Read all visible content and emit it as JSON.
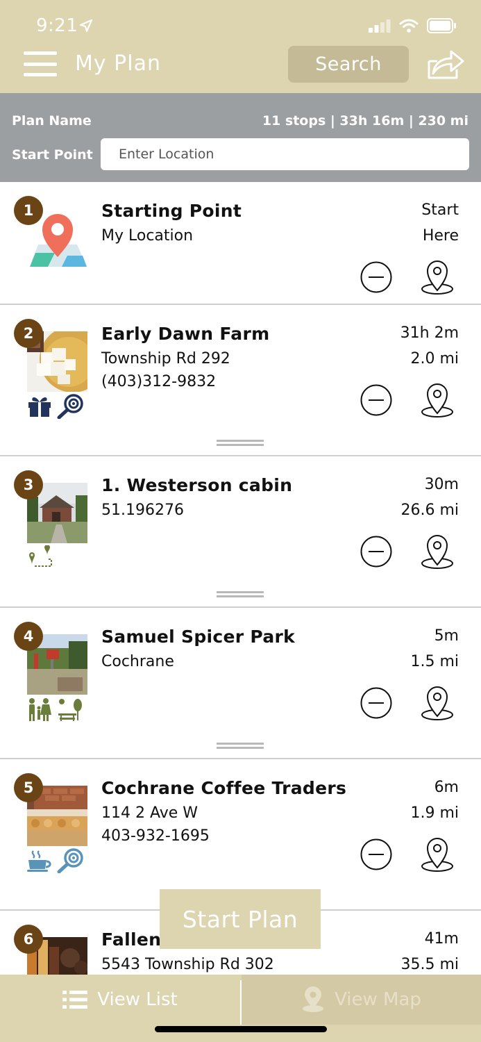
{
  "status": {
    "time": "9:21"
  },
  "header": {
    "title": "My Plan",
    "search_label": "Search"
  },
  "plan": {
    "name_label": "Plan Name",
    "stats": "11 stops | 33h 16m | 230 mi",
    "start_label": "Start Point",
    "location_placeholder": "Enter Location"
  },
  "stops": [
    {
      "num": "1",
      "name": "Starting Point",
      "line1": "My Location",
      "line2": "",
      "right1": "Start",
      "right2": "Here"
    },
    {
      "num": "2",
      "name": "Early Dawn Farm",
      "line1": "Township Rd 292",
      "line2": "(403)312-9832",
      "right1": "31h 2m",
      "right2": "2.0 mi"
    },
    {
      "num": "3",
      "name": "1. Westerson cabin",
      "line1": "51.196276",
      "line2": "",
      "right1": "30m",
      "right2": "26.6 mi"
    },
    {
      "num": "4",
      "name": "Samuel Spicer Park",
      "line1": "Cochrane",
      "line2": "",
      "right1": "5m",
      "right2": "1.5 mi"
    },
    {
      "num": "5",
      "name": "Cochrane Coffee Traders",
      "line1": "114 2 Ave W",
      "line2": "403-932-1695",
      "right1": "6m",
      "right2": "1.9 mi"
    },
    {
      "num": "6",
      "name": "Fallent",
      "line1": "5543 Township Rd 302",
      "line2": "",
      "right1": "41m",
      "right2": "35.5 mi"
    }
  ],
  "start_plan_label": "Start Plan",
  "tabs": {
    "list_label": "View List",
    "map_label": "View Map"
  },
  "colors": {
    "header": "#ddd4b0",
    "plan_bar": "#9c9fa2",
    "badge": "#6b4416",
    "accent_green": "#6b7d3a",
    "accent_navy": "#22335e"
  }
}
